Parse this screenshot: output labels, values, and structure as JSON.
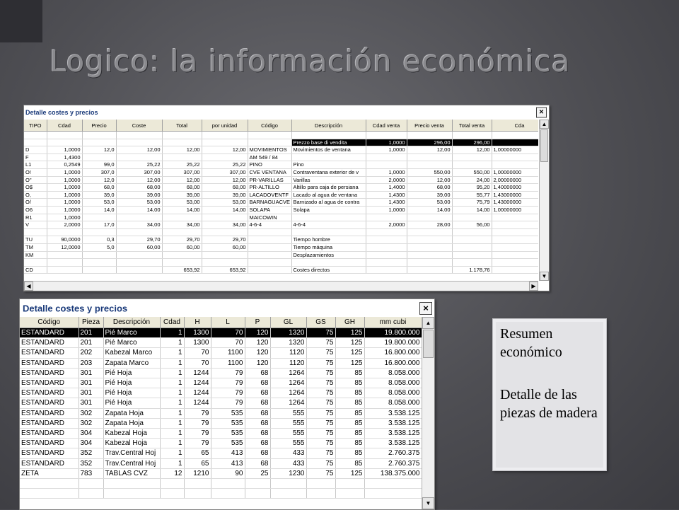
{
  "slide": {
    "title": "Logico: la información económica",
    "side_text_1": "Resumen económico",
    "side_text_2": "Detalle de las piezas de madera"
  },
  "window1": {
    "title": "Detalle costes y precios",
    "close_label": "×",
    "columns": [
      "TIPO",
      "Cdad",
      "Precio",
      "Coste",
      "Total",
      "por unidad",
      "Código",
      "Descripción",
      "Cdad venta",
      "Precio venta",
      "Total venta",
      "Cda"
    ],
    "rows": [
      [
        "",
        "",
        "",
        "",
        "",
        "",
        "",
        "",
        "",
        "",
        "",
        ""
      ],
      [
        "",
        "",
        "",
        "",
        "",
        "",
        "",
        "Prezzo  base di vendita",
        "1,0000",
        "296,00",
        "296,00",
        ""
      ],
      [
        "D",
        "1,0000",
        "12,0",
        "12,00",
        "12,00",
        "12,00",
        "MOVIMIENTOS",
        "Movimientos de ventana",
        "1,0000",
        "12,00",
        "12,00",
        "1,00000000"
      ],
      [
        "F",
        "1,4300",
        "",
        "",
        "",
        "",
        "AM 549 / 84",
        "",
        "",
        "",
        "",
        ""
      ],
      [
        "L1",
        "0,2549",
        "99,0",
        "25,22",
        "25,22",
        "25,22",
        "PINO",
        "Pino",
        "",
        "",
        "",
        ""
      ],
      [
        "O!",
        "1,0000",
        "307,0",
        "307,00",
        "307,00",
        "307,00",
        "CVE VENTANA",
        "Contraventana exterior de v",
        "1,0000",
        "550,00",
        "550,00",
        "1,00000000"
      ],
      [
        "O\"",
        "1,0000",
        "12,0",
        "12,00",
        "12,00",
        "12,00",
        "PR-VARILLAS",
        "Varillas",
        "2,0000",
        "12,00",
        "24,00",
        "2,00000000"
      ],
      [
        "O$",
        "1,0000",
        "68,0",
        "68,00",
        "68,00",
        "68,00",
        "PR-ALTILLO",
        "Altillo para caja de persiana",
        "1,4000",
        "68,00",
        "95,20",
        "1,40000000"
      ],
      [
        "O,",
        "1,0000",
        "39,0",
        "39,00",
        "39,00",
        "39,00",
        "LACADOVENTF",
        "Lacado al agua de ventana",
        "1,4300",
        "39,00",
        "55,77",
        "1,43000000"
      ],
      [
        "O/",
        "1,0000",
        "53,0",
        "53,00",
        "53,00",
        "53,00",
        "BARNAGUACVE",
        "Barnizado al agua de contra",
        "1,4300",
        "53,00",
        "75,79",
        "1,43000000"
      ],
      [
        "O6",
        "1,0000",
        "14,0",
        "14,00",
        "14,00",
        "14,00",
        "SOLAPA",
        "Solapa",
        "1,0000",
        "14,00",
        "14,00",
        "1,00000000"
      ],
      [
        "R1",
        "1,0000",
        "",
        "",
        "",
        "",
        "MAICOWIN",
        "",
        "",
        "",
        "",
        ""
      ],
      [
        "V",
        "2,0000",
        "17,0",
        "34,00",
        "34,00",
        "34,00",
        "4-6-4",
        "4-6-4",
        "2,0000",
        "28,00",
        "56,00",
        ""
      ],
      [
        "",
        "",
        "",
        "",
        "",
        "",
        "",
        "",
        "",
        "",
        "",
        ""
      ],
      [
        "TU",
        "90,0000",
        "0,3",
        "29,70",
        "29,70",
        "29,70",
        "",
        "Tiempo hombre",
        "",
        "",
        "",
        ""
      ],
      [
        "TM",
        "12,0000",
        "5,0",
        "60,00",
        "60,00",
        "60,00",
        "",
        "Tiempo máquina",
        "",
        "",
        "",
        ""
      ],
      [
        "KM",
        "",
        "",
        "",
        "",
        "",
        "",
        "Desplazamientos",
        "",
        "",
        "",
        ""
      ],
      [
        "",
        "",
        "",
        "",
        "",
        "",
        "",
        "",
        "",
        "",
        "",
        ""
      ],
      [
        "CD",
        "",
        "",
        "",
        "653,92",
        "653,92",
        "",
        "Costes directos",
        "",
        "",
        "1.178,76",
        ""
      ]
    ]
  },
  "window2": {
    "title": "Detalle costes y precios",
    "close_label": "×",
    "columns": [
      "Código",
      "Pieza",
      "Descripción",
      "Cdad",
      "H",
      "L",
      "P",
      "GL",
      "GS",
      "GH",
      "mm cubi"
    ],
    "rows": [
      [
        "ESTANDARD",
        "201",
        "Pié Marco",
        "1",
        "1300",
        "70",
        "120",
        "1320",
        "75",
        "125",
        "19.800.000"
      ],
      [
        "ESTANDARD",
        "201",
        "Pié Marco",
        "1",
        "1300",
        "70",
        "120",
        "1320",
        "75",
        "125",
        "19.800.000"
      ],
      [
        "ESTANDARD",
        "202",
        "Kabezal Marco",
        "1",
        "70",
        "1100",
        "120",
        "1120",
        "75",
        "125",
        "16.800.000"
      ],
      [
        "ESTANDARD",
        "203",
        "Zapata Marco",
        "1",
        "70",
        "1100",
        "120",
        "1120",
        "75",
        "125",
        "16.800.000"
      ],
      [
        "ESTANDARD",
        "301",
        "Pié Hoja",
        "1",
        "1244",
        "79",
        "68",
        "1264",
        "75",
        "85",
        "8.058.000"
      ],
      [
        "ESTANDARD",
        "301",
        "Pié Hoja",
        "1",
        "1244",
        "79",
        "68",
        "1264",
        "75",
        "85",
        "8.058.000"
      ],
      [
        "ESTANDARD",
        "301",
        "Pié Hoja",
        "1",
        "1244",
        "79",
        "68",
        "1264",
        "75",
        "85",
        "8.058.000"
      ],
      [
        "ESTANDARD",
        "301",
        "Pié Hoja",
        "1",
        "1244",
        "79",
        "68",
        "1264",
        "75",
        "85",
        "8.058.000"
      ],
      [
        "ESTANDARD",
        "302",
        "Zapata Hoja",
        "1",
        "79",
        "535",
        "68",
        "555",
        "75",
        "85",
        "3.538.125"
      ],
      [
        "ESTANDARD",
        "302",
        "Zapata Hoja",
        "1",
        "79",
        "535",
        "68",
        "555",
        "75",
        "85",
        "3.538.125"
      ],
      [
        "ESTANDARD",
        "304",
        "Kabezal Hoja",
        "1",
        "79",
        "535",
        "68",
        "555",
        "75",
        "85",
        "3.538.125"
      ],
      [
        "ESTANDARD",
        "304",
        "Kabezal Hoja",
        "1",
        "79",
        "535",
        "68",
        "555",
        "75",
        "85",
        "3.538.125"
      ],
      [
        "ESTANDARD",
        "352",
        "Trav.Central Hoj",
        "1",
        "65",
        "413",
        "68",
        "433",
        "75",
        "85",
        "2.760.375"
      ],
      [
        "ESTANDARD",
        "352",
        "Trav.Central Hoj",
        "1",
        "65",
        "413",
        "68",
        "433",
        "75",
        "85",
        "2.760.375"
      ],
      [
        "ZETA",
        "783",
        "TABLAS CVZ",
        "12",
        "1210",
        "90",
        "25",
        "1230",
        "75",
        "125",
        "138.375.000"
      ],
      [
        "",
        "",
        "",
        "",
        "",
        "",
        "",
        "",
        "",
        "",
        ""
      ],
      [
        "",
        "",
        "",
        "",
        "",
        "",
        "",
        "",
        "",
        "",
        ""
      ]
    ]
  }
}
